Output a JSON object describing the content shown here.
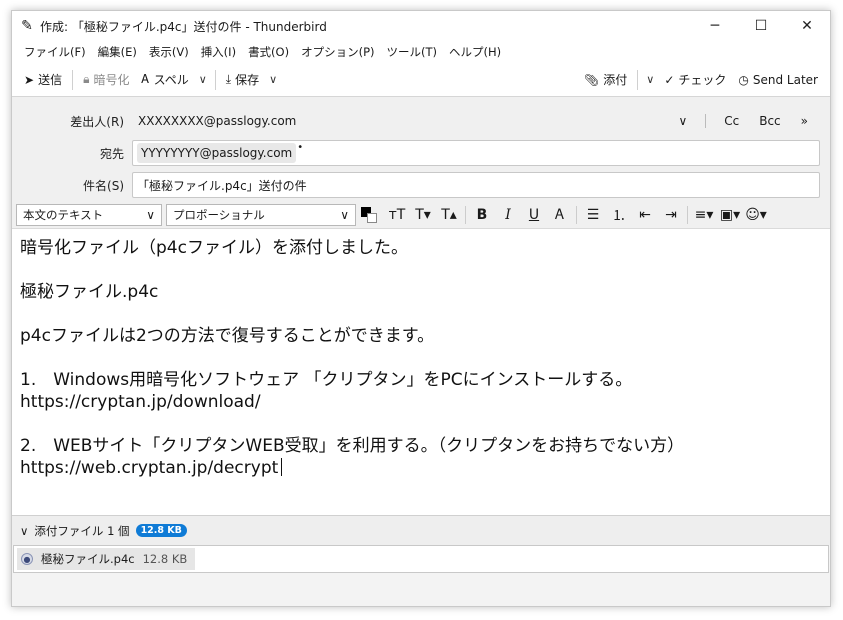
{
  "window": {
    "title": "作成: 「極秘ファイル.p4c」送付の件 - Thunderbird",
    "minimize": "─",
    "maximize": "☐",
    "close": "✕"
  },
  "menu": [
    "ファイル(F)",
    "編集(E)",
    "表示(V)",
    "挿入(I)",
    "書式(O)",
    "オプション(P)",
    "ツール(T)",
    "ヘルプ(H)"
  ],
  "toolbar": {
    "send": "送信",
    "encrypt": "暗号化",
    "spell": "スペル",
    "save": "保存",
    "attach": "添付",
    "check": "チェック",
    "send_later": "Send Later"
  },
  "header": {
    "from_label": "差出人(R)",
    "from_value": "XXXXXXXX@passlogy.com",
    "cc": "Cc",
    "bcc": "Bcc",
    "more": "»",
    "to_label": "宛先",
    "to_value": "YYYYYYYY@passlogy.com",
    "subject_label": "件名(S)",
    "subject_value": "「極秘ファイル.p4c」送付の件"
  },
  "format": {
    "paragraph": "本文のテキスト",
    "font": "プロポーショナル"
  },
  "body_lines": [
    "暗号化ファイル（p4cファイル）を添付しました。",
    "",
    "極秘ファイル.p4c",
    "",
    "p4cファイルは2つの方法で復号することができます。",
    "",
    "1.　Windows用暗号化ソフトウェア 「クリプタン」をPCにインストールする。",
    "https://cryptan.jp/download/",
    "",
    "2.　WEBサイト「クリプタンWEB受取」を利用する。（クリプタンをお持ちでない方）",
    "https://web.cryptan.jp/decrypt"
  ],
  "attachments": {
    "header": "添付ファイル 1 個",
    "total_size": "12.8 KB",
    "items": [
      {
        "name": "極秘ファイル.p4c",
        "size": "12.8 KB"
      }
    ]
  }
}
